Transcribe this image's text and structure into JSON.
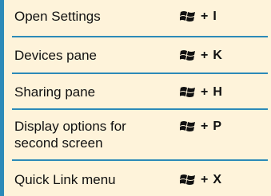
{
  "shortcuts": [
    {
      "action": "Open Settings",
      "modifier": "windows-logo-icon",
      "plus": "+",
      "key": "I"
    },
    {
      "action": "Devices pane",
      "modifier": "windows-logo-icon",
      "plus": "+",
      "key": "K"
    },
    {
      "action": "Sharing pane",
      "modifier": "windows-logo-icon",
      "plus": "+",
      "key": "H"
    },
    {
      "action_line1": "Display options for",
      "action_line2": "second screen",
      "modifier": "windows-logo-icon",
      "plus": "+",
      "key": "P"
    },
    {
      "action": "Quick Link menu",
      "modifier": "windows-logo-icon",
      "plus": "+",
      "key": "X"
    }
  ],
  "colors": {
    "background": "#fef3da",
    "divider": "#2c8ab8",
    "text": "#111111"
  }
}
